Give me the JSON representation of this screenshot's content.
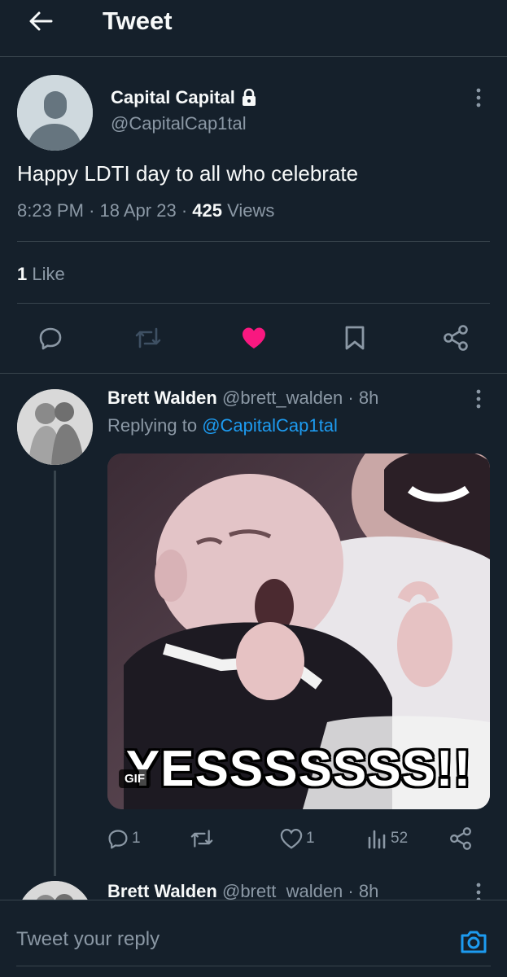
{
  "header": {
    "title": "Tweet"
  },
  "tweet": {
    "author_name": "Capital Capital",
    "author_handle": "@CapitalCap1tal",
    "text": "Happy LDTI day to all who celebrate",
    "time": "8:23 PM",
    "sep1": "·",
    "date": "18 Apr 23",
    "sep2": "·",
    "views_count": "425",
    "views_label": "Views",
    "likes_count": "1",
    "likes_label": "Like",
    "actions": [
      "reply-icon",
      "retweet-icon",
      "like-icon",
      "bookmark-icon",
      "share-icon"
    ],
    "like_color": "#f91880"
  },
  "replies": [
    {
      "author_name": "Brett Walden",
      "author_handle": "@brett_walden",
      "sep": "·",
      "time": "8h",
      "replying_prefix": "Replying to",
      "replying_to": "@CapitalCap1tal",
      "gif_caption": "YESSSSSSS!!",
      "gif_badge": "GIF",
      "reply_count": "1",
      "retweet_count": "",
      "like_count": "1",
      "views_count": "52"
    },
    {
      "author_name": "Brett Walden",
      "author_handle": "@brett_walden",
      "sep": "·",
      "time": "8h"
    }
  ],
  "composer": {
    "placeholder": "Tweet your reply"
  },
  "colors": {
    "background": "#15202b",
    "accent": "#1d9bf0",
    "muted": "#8b98a5",
    "border": "#38444d"
  }
}
